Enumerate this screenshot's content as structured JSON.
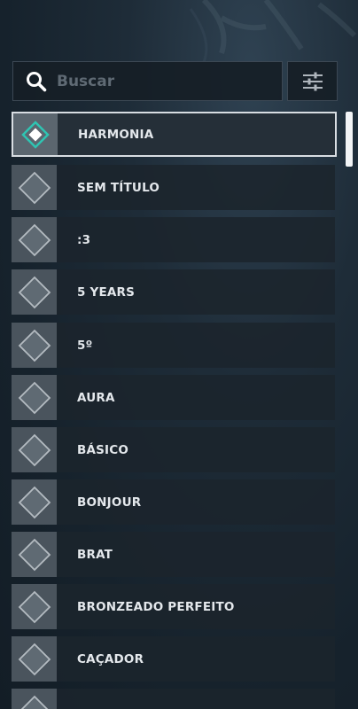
{
  "search": {
    "placeholder": "Buscar",
    "value": "",
    "icon": "search-icon"
  },
  "filter": {
    "icon": "sliders-icon"
  },
  "colors": {
    "accent": "#2fc4b2",
    "selected_border": "#d8dde2",
    "text": "#e4e8ec"
  },
  "items": [
    {
      "label": "HARMONIA",
      "selected": true
    },
    {
      "label": "SEM TÍTULO",
      "selected": false
    },
    {
      "label": ":3",
      "selected": false
    },
    {
      "label": "5 YEARS",
      "selected": false
    },
    {
      "label": "5º",
      "selected": false
    },
    {
      "label": "AURA",
      "selected": false
    },
    {
      "label": "BÁSICO",
      "selected": false
    },
    {
      "label": "BONJOUR",
      "selected": false
    },
    {
      "label": "BRAT",
      "selected": false
    },
    {
      "label": "BRONZEADO PERFEITO",
      "selected": false
    },
    {
      "label": "CAÇADOR",
      "selected": false
    },
    {
      "label": "",
      "selected": false
    }
  ]
}
